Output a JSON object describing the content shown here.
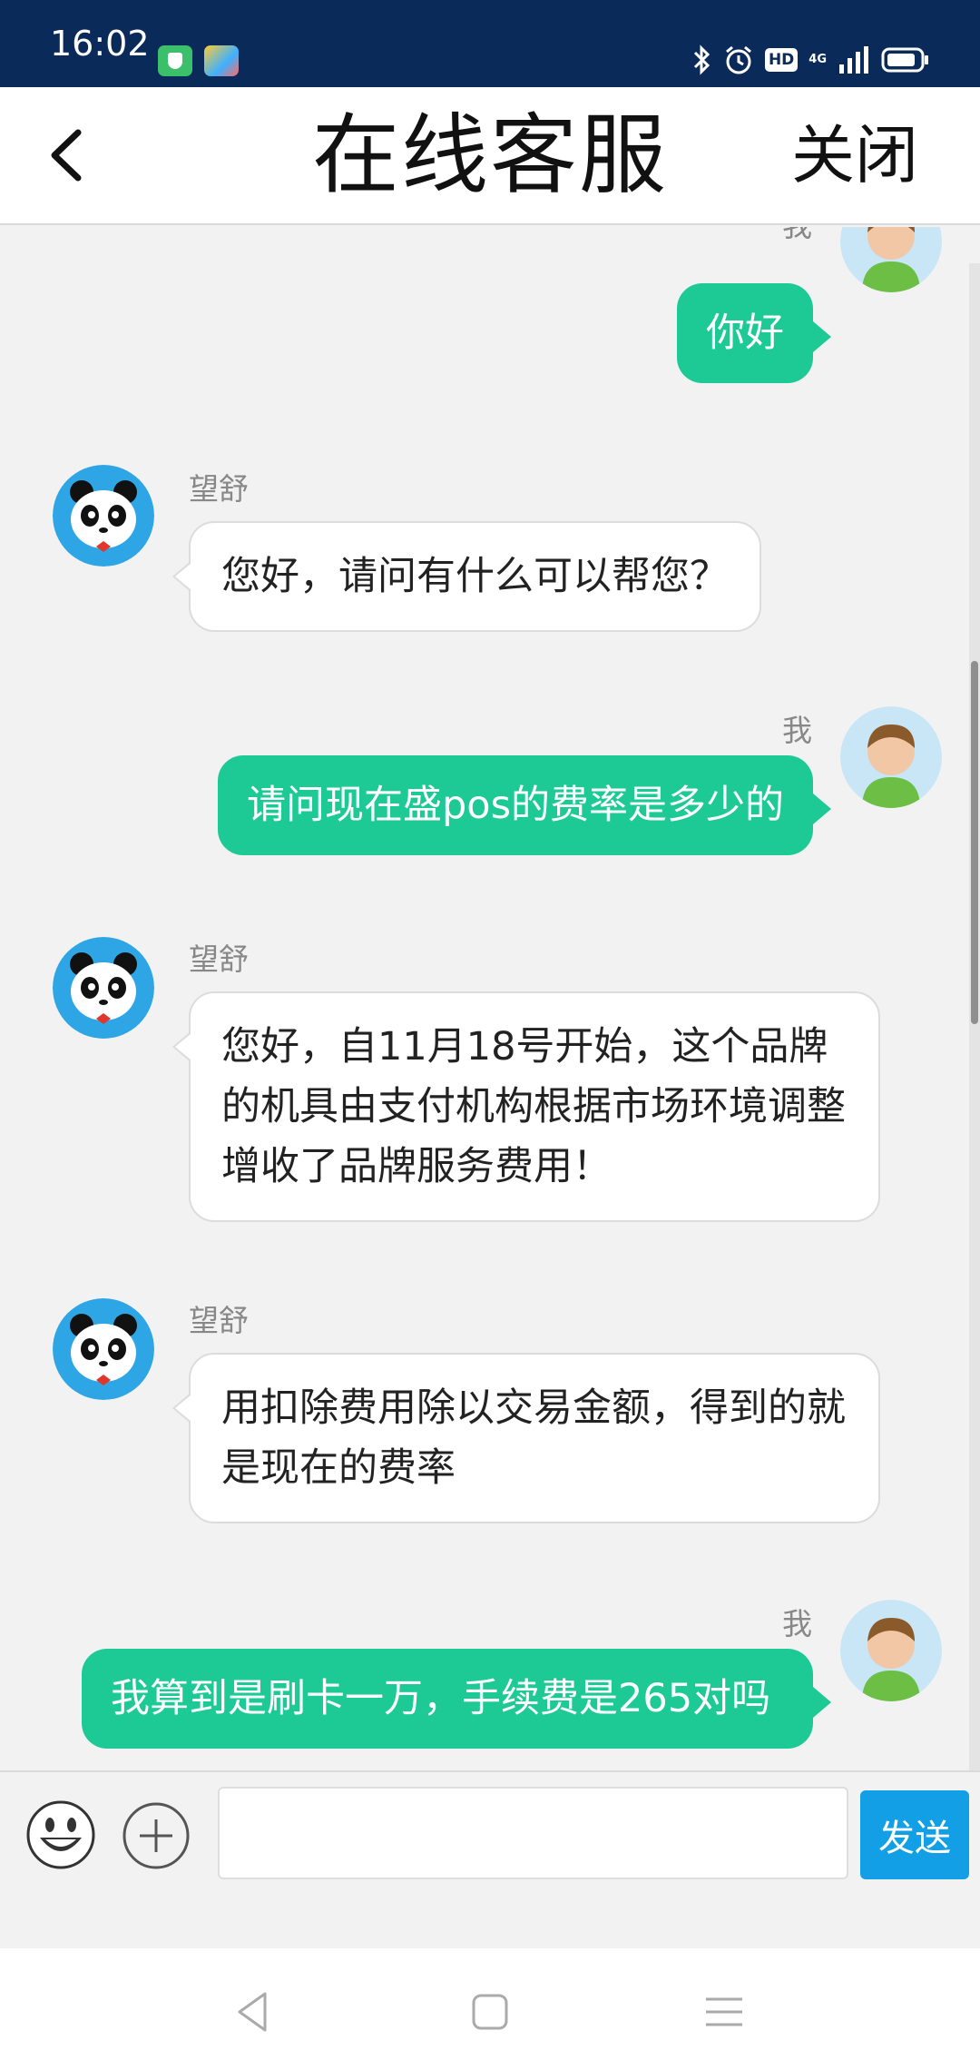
{
  "status_bar": {
    "time": "16:02",
    "hd_label": "HD",
    "network_label": "4G",
    "icons": [
      "app-shield-icon",
      "app-colorful-icon",
      "bluetooth-icon",
      "alarm-icon",
      "hd-icon",
      "signal-icon",
      "battery-icon"
    ]
  },
  "header": {
    "back_icon": "back-arrow-icon",
    "title": "在线客服",
    "close_label": "关闭"
  },
  "messages": [
    {
      "direction": "out",
      "sender": "我",
      "text": "你好"
    },
    {
      "direction": "in",
      "sender": "望舒",
      "text": "您好，请问有什么可以帮您？"
    },
    {
      "direction": "out",
      "sender": "我",
      "text": "请问现在盛pos的费率是多少的"
    },
    {
      "direction": "in",
      "sender": "望舒",
      "text": "您好，自11月18号开始，这个品牌的机具由支付机构根据市场环境调整增收了品牌服务费用！"
    },
    {
      "direction": "in",
      "sender": "望舒",
      "text": "用扣除费用除以交易金额，得到的就是现在的费率"
    },
    {
      "direction": "out",
      "sender": "我",
      "text": "我算到是刷卡一万，手续费是265对吗"
    }
  ],
  "input_bar": {
    "emoji_icon": "emoji-icon",
    "plus_icon": "plus-icon",
    "input_value": "",
    "send_label": "发送"
  },
  "nav_bar": {
    "icons": [
      "nav-back-icon",
      "nav-home-icon",
      "nav-menu-icon"
    ]
  },
  "colors": {
    "status_bar": "#0a2a5a",
    "outgoing_bubble": "#1dc994",
    "send_button": "#129fe6",
    "chat_background": "#f2f2f2"
  }
}
